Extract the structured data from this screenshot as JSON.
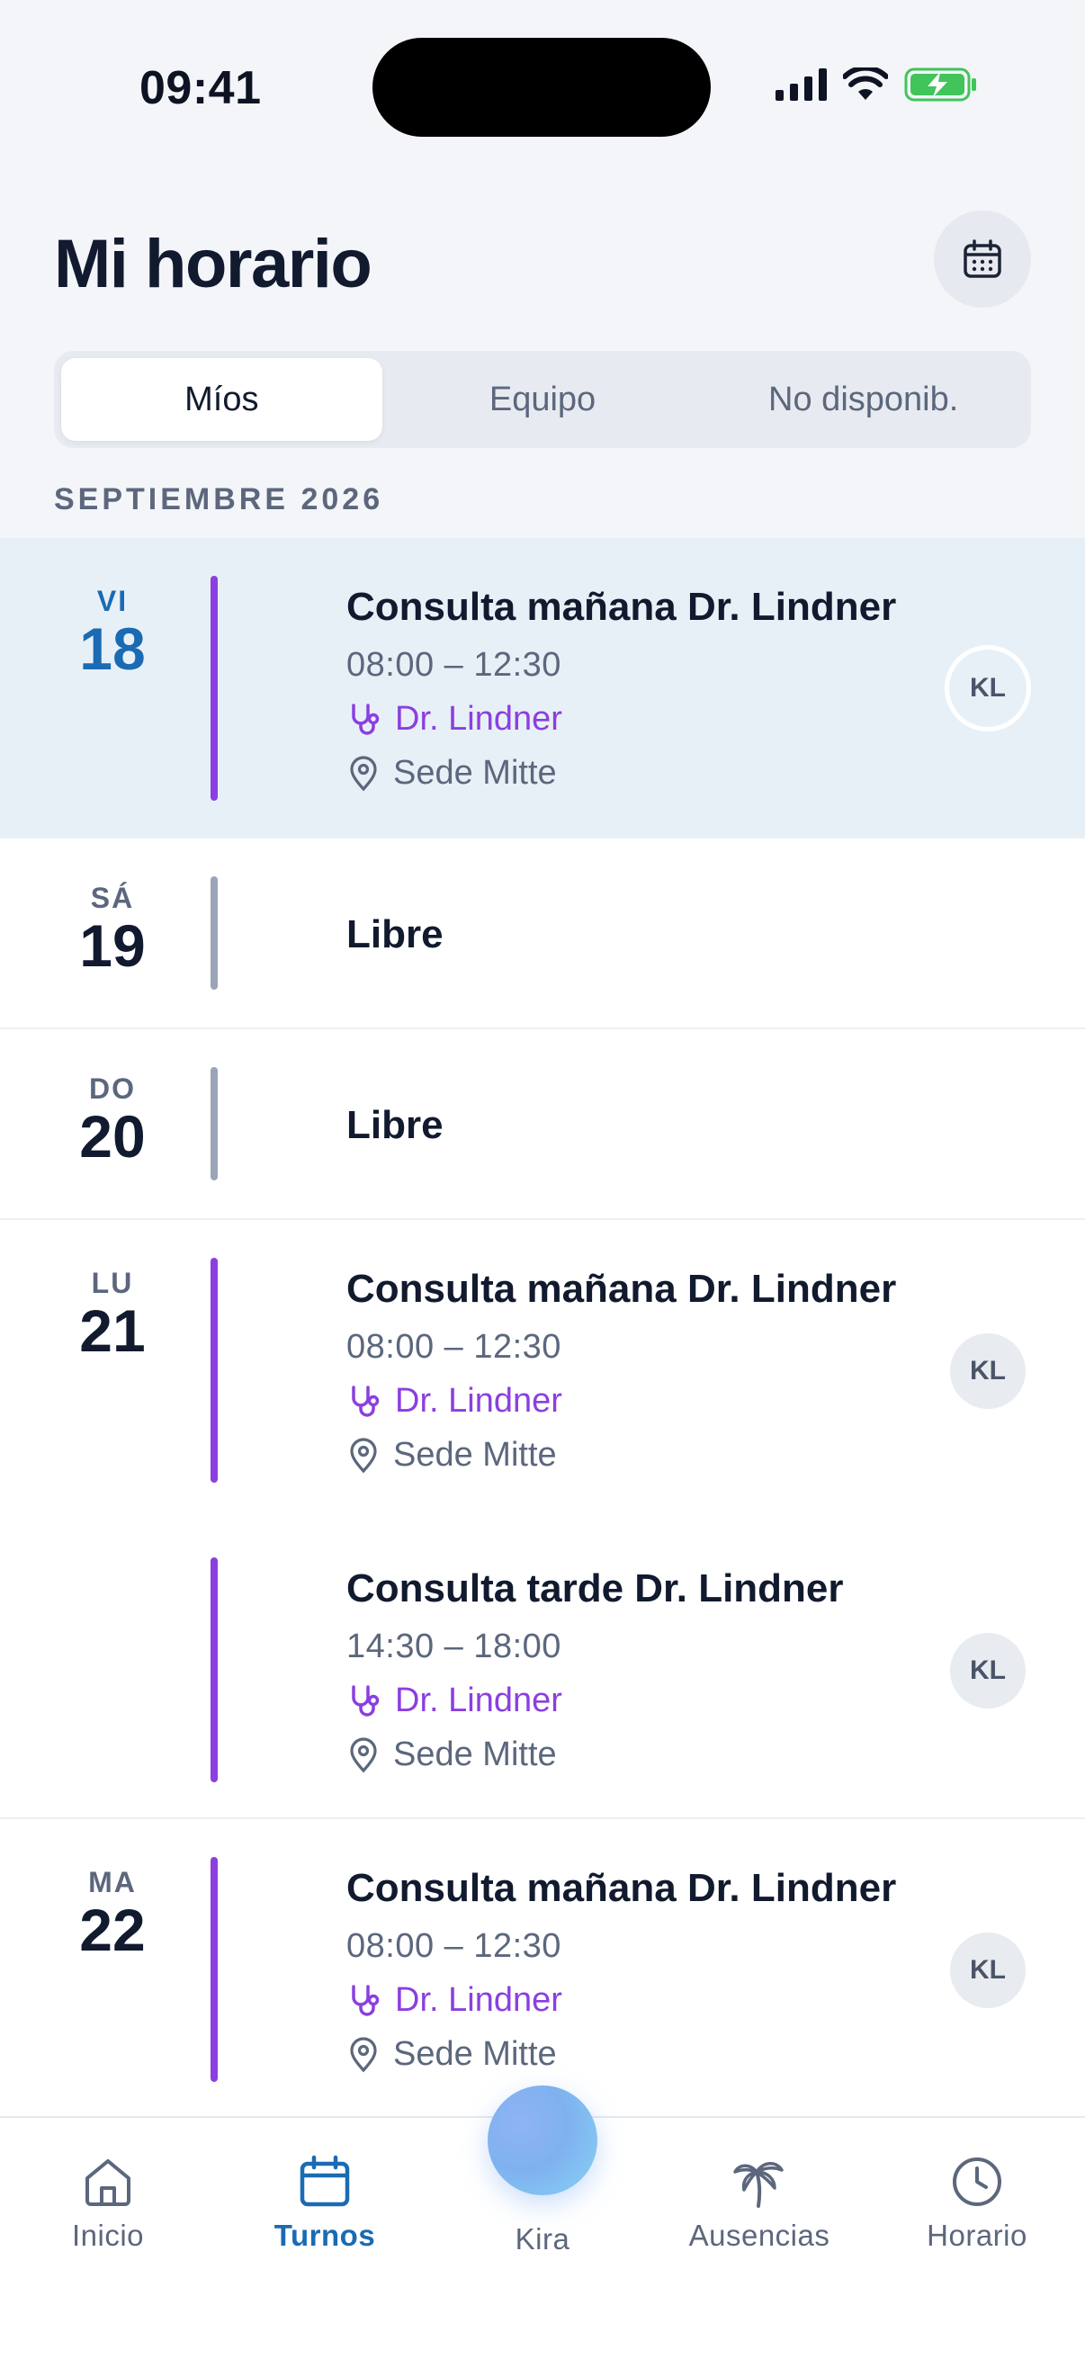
{
  "status_bar": {
    "time": "09:41"
  },
  "header": {
    "title": "Mi horario",
    "calendar_icon": "calendar-icon"
  },
  "segments": [
    {
      "label": "Míos",
      "active": true
    },
    {
      "label": "Equipo",
      "active": false
    },
    {
      "label": "No disponib.",
      "active": false
    }
  ],
  "month_label": "SEPTIEMBRE 2026",
  "days": [
    {
      "dow": "VI",
      "day": "18",
      "today": true,
      "shifts": [
        {
          "title": "Consulta mañana Dr. Lindner",
          "time": "08:00 – 12:30",
          "doctor": "Dr. Lindner",
          "location": "Sede Mitte",
          "avatar": "KL"
        }
      ]
    },
    {
      "dow": "SÁ",
      "day": "19",
      "free_label": "Libre"
    },
    {
      "dow": "DO",
      "day": "20",
      "free_label": "Libre"
    },
    {
      "dow": "LU",
      "day": "21",
      "shifts": [
        {
          "title": "Consulta mañana Dr. Lindner",
          "time": "08:00 – 12:30",
          "doctor": "Dr. Lindner",
          "location": "Sede Mitte",
          "avatar": "KL"
        },
        {
          "title": "Consulta tarde Dr. Lindner",
          "time": "14:30 – 18:00",
          "doctor": "Dr. Lindner",
          "location": "Sede Mitte",
          "avatar": "KL"
        }
      ]
    },
    {
      "dow": "MA",
      "day": "22",
      "shifts": [
        {
          "title": "Consulta mañana Dr. Lindner",
          "time": "08:00 – 12:30",
          "doctor": "Dr. Lindner",
          "location": "Sede Mitte",
          "avatar": "KL"
        }
      ]
    }
  ],
  "tabs": [
    {
      "label": "Inicio",
      "icon": "home-icon"
    },
    {
      "label": "Turnos",
      "icon": "calendar-icon",
      "active": true
    },
    {
      "label": "Kira",
      "icon": "kira-orb"
    },
    {
      "label": "Ausencias",
      "icon": "palm-tree-icon"
    },
    {
      "label": "Horario",
      "icon": "clock-icon"
    }
  ],
  "colors": {
    "accent": "#1a6bb3",
    "shift_bar": "#8b3fe0",
    "free_bar": "#9aa5b8",
    "today_bg": "#e8f0f7"
  }
}
